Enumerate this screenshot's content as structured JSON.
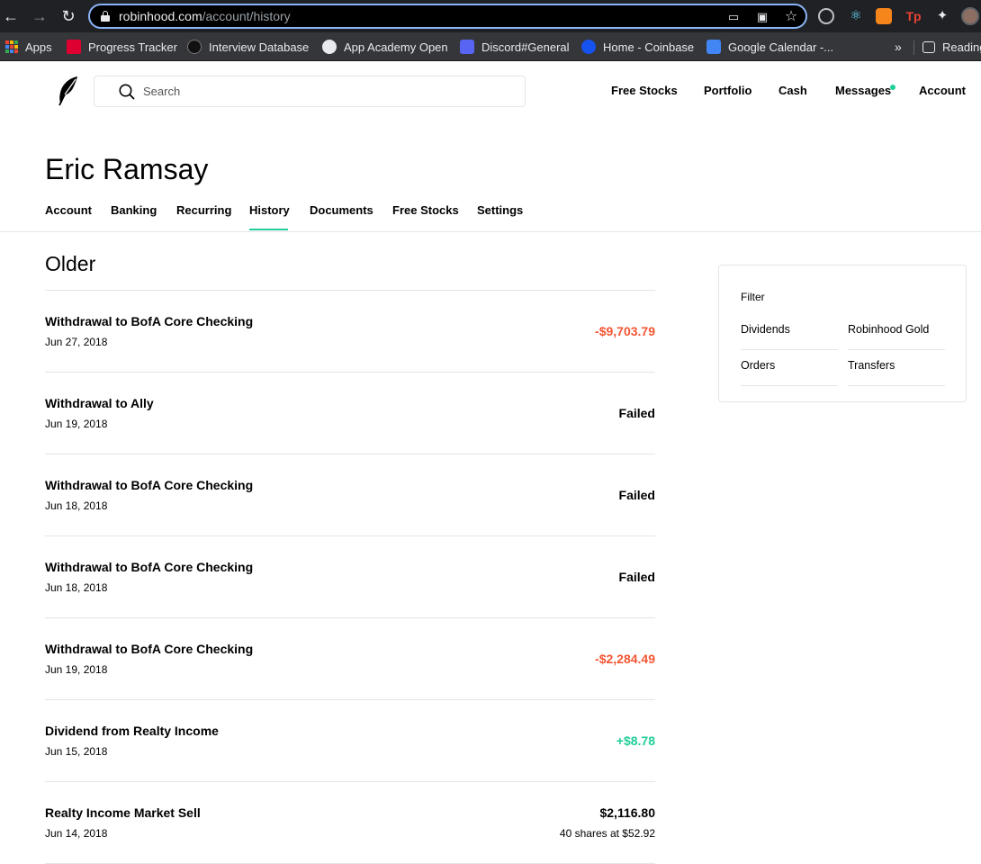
{
  "browser": {
    "url_host": "robinhood.com",
    "url_path": "/account/history",
    "bookmarks": [
      {
        "label": "Apps",
        "icon": "apps-grid-icon"
      },
      {
        "label": "Progress Tracker",
        "icon": "angular-icon",
        "color": "#dd0031"
      },
      {
        "label": "Interview Database",
        "icon": "database-icon",
        "color": "#555555"
      },
      {
        "label": "App Academy Open",
        "icon": "globe-icon",
        "color": "#e8eaed"
      },
      {
        "label": "Discord#General",
        "icon": "discord-icon",
        "color": "#ed4245"
      },
      {
        "label": "Home - Coinbase",
        "icon": "coinbase-icon",
        "color": "#1652f0"
      },
      {
        "label": "Google Calendar -...",
        "icon": "calendar-icon",
        "color": "#4285f4"
      },
      {
        "label": "Reading",
        "icon": "reading-list-icon"
      }
    ],
    "overflow_label": "»"
  },
  "header": {
    "search_placeholder": "Search",
    "nav": [
      "Free Stocks",
      "Portfolio",
      "Cash",
      "Messages",
      "Account"
    ]
  },
  "profile": {
    "name": "Eric Ramsay",
    "tabs": [
      "Account",
      "Banking",
      "Recurring",
      "History",
      "Documents",
      "Free Stocks",
      "Settings"
    ],
    "active_tab": "History"
  },
  "history": {
    "section_title": "Older",
    "items": [
      {
        "title": "Withdrawal to BofA Core Checking",
        "date": "Jun 27, 2018",
        "amount": "-$9,703.79",
        "status": "negative"
      },
      {
        "title": "Withdrawal to Ally",
        "date": "Jun 19, 2018",
        "amount": "Failed",
        "status": "neutral"
      },
      {
        "title": "Withdrawal to BofA Core Checking",
        "date": "Jun 18, 2018",
        "amount": "Failed",
        "status": "neutral"
      },
      {
        "title": "Withdrawal to BofA Core Checking",
        "date": "Jun 18, 2018",
        "amount": "Failed",
        "status": "neutral"
      },
      {
        "title": "Withdrawal to BofA Core Checking",
        "date": "Jun 19, 2018",
        "amount": "-$2,284.49",
        "status": "negative"
      },
      {
        "title": "Dividend from Realty Income",
        "date": "Jun 15, 2018",
        "amount": "+$8.78",
        "status": "positive"
      },
      {
        "title": "Realty Income Market Sell",
        "date": "Jun 14, 2018",
        "amount": "$2,116.80",
        "detail": "40 shares at $52.92",
        "status": "neutral"
      }
    ]
  },
  "filter": {
    "title": "Filter",
    "options": [
      "Dividends",
      "Robinhood Gold",
      "Orders",
      "Transfers"
    ]
  },
  "colors": {
    "negative": "#f45531",
    "positive": "#21ce99",
    "neutral": "#000000",
    "accent": "#21ce99"
  }
}
